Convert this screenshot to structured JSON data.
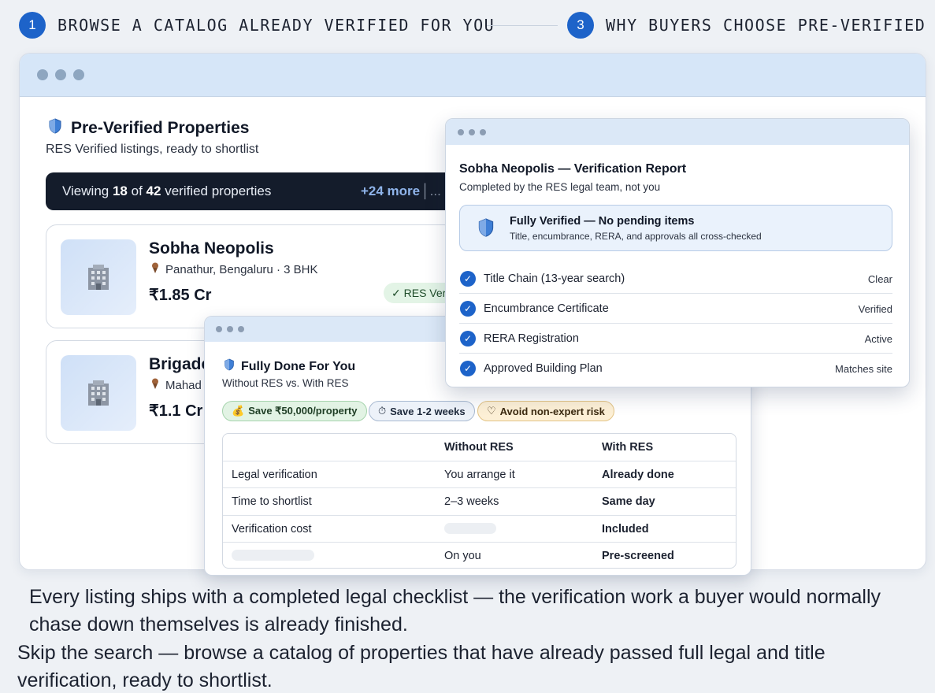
{
  "steps": {
    "left": {
      "number": "1",
      "text": "BROWSE A CATALOG ALREADY VERIFIED FOR YOU"
    },
    "right": {
      "number": "3",
      "text": "WHY BUYERS CHOOSE PRE-VERIFIED"
    }
  },
  "catalog": {
    "title": "Pre-Verified Properties",
    "subtitle": "RES Verified listings, ready to shortlist",
    "viewing": {
      "prefix": "Viewing",
      "shown": "18",
      "of": "of",
      "total": "42",
      "suffix": "verified properties",
      "more": "+24 more",
      "ellipsis": "│..."
    },
    "properties": [
      {
        "name": "Sobha Neopolis",
        "location": "Panathur, Bengaluru · 3 BHK",
        "price": "₹1.85 Cr",
        "badge": "✓ RES Verified"
      },
      {
        "name": "Brigade",
        "location": "Mahad",
        "price": "₹1.1 Cr"
      }
    ]
  },
  "comparison": {
    "title": "Fully Done For You",
    "subtitle": "Without RES vs. With RES",
    "chips": [
      {
        "icon": "💰",
        "label": "Save ₹50,000/property"
      },
      {
        "icon": "⏱",
        "label": "Save 1-2 weeks"
      },
      {
        "icon": "♡",
        "label": "Avoid non-expert risk"
      }
    ],
    "headers": [
      "",
      "Without RES",
      "With RES"
    ],
    "rows": [
      [
        "Legal verification",
        "You arrange it",
        "Already done"
      ],
      [
        "Time to shortlist",
        "2–3 weeks",
        "Same day"
      ],
      [
        "Verification cost",
        "",
        "Included"
      ],
      [
        "",
        "On you",
        "Pre-screened"
      ]
    ]
  },
  "report": {
    "title": "Sobha Neopolis — Verification Report",
    "subtitle": "Completed by the RES legal team, not you",
    "status_title": "Fully Verified — No pending items",
    "status_sub": "Title, encumbrance, RERA, and approvals all cross-checked",
    "checks": [
      {
        "label": "Title Chain (13-year search)",
        "status": "Clear"
      },
      {
        "label": "Encumbrance Certificate",
        "status": "Verified"
      },
      {
        "label": "RERA Registration",
        "status": "Active"
      },
      {
        "label": "Approved Building Plan",
        "status": "Matches site"
      }
    ]
  },
  "captions": {
    "line1": "Every listing ships with a completed legal checklist — the verification work a buyer would normally chase down themselves is already finished.",
    "line2": "Skip the search — browse a catalog of properties that have already passed full legal and title verification, ready to shortlist."
  },
  "colors": {
    "accent": "#1d63c9",
    "dark_bar": "#141c2b",
    "titlebar": "#d6e6f8"
  }
}
